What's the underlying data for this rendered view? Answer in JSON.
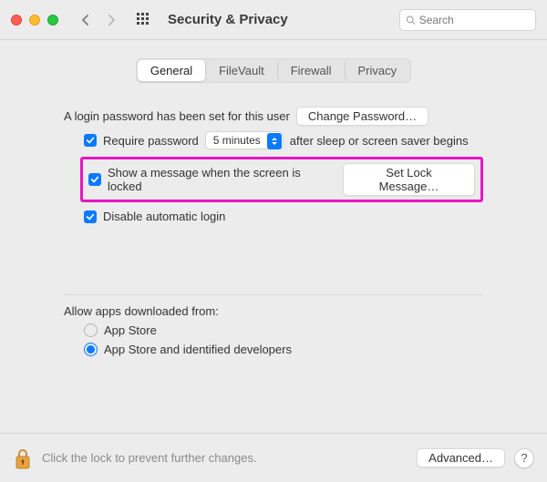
{
  "header": {
    "title": "Security & Privacy",
    "search_placeholder": "Search"
  },
  "tabs": {
    "general": "General",
    "filevault": "FileVault",
    "firewall": "Firewall",
    "privacy": "Privacy"
  },
  "general": {
    "login_pw_text": "A login password has been set for this user",
    "change_password_btn": "Change Password…",
    "require_password_label": "Require password",
    "require_password_delay": "5 minutes",
    "require_password_suffix": "after sleep or screen saver begins",
    "show_message_label": "Show a message when the screen is locked",
    "set_lock_message_btn": "Set Lock Message…",
    "disable_auto_login_label": "Disable automatic login"
  },
  "downloads": {
    "title": "Allow apps downloaded from:",
    "app_store": "App Store",
    "identified": "App Store and identified developers"
  },
  "footer": {
    "lock_text": "Click the lock to prevent further changes.",
    "advanced_btn": "Advanced…",
    "help": "?"
  }
}
